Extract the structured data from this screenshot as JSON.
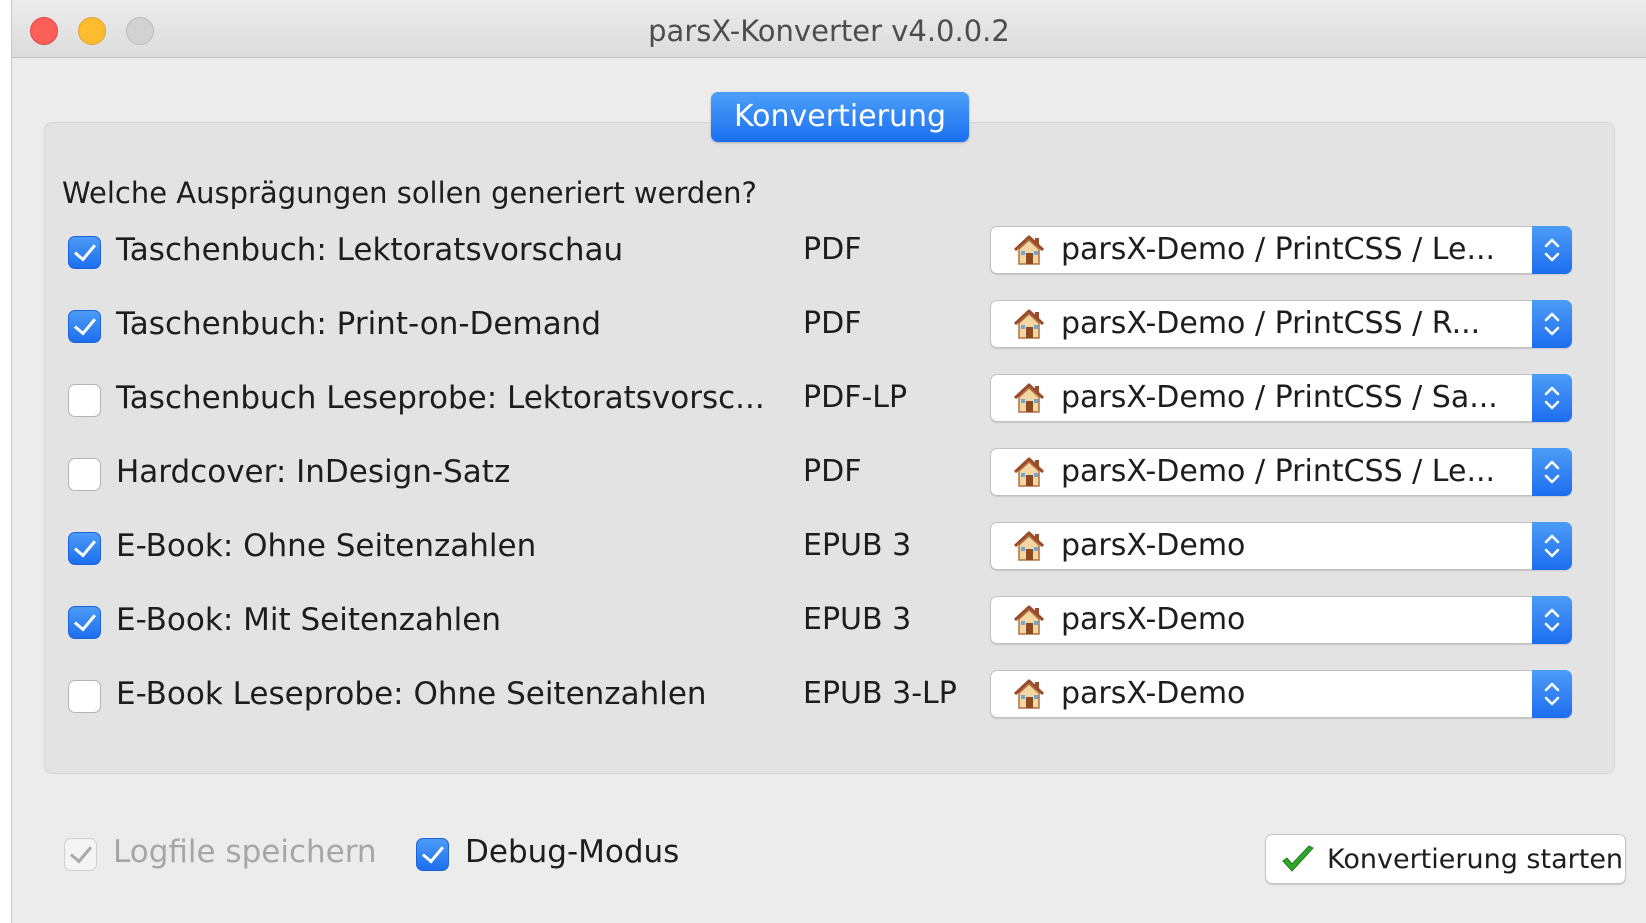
{
  "window": {
    "title": "parsX-Konverter v4.0.0.2"
  },
  "tab": {
    "label": "Konvertierung"
  },
  "question": "Welche Ausprägungen sollen generiert werden?",
  "rows": [
    {
      "checked": true,
      "label": "Taschenbuch: Lektoratsvorschau",
      "format": "PDF",
      "select": "parsX-Demo / PrintCSS / Le..."
    },
    {
      "checked": true,
      "label": "Taschenbuch: Print-on-Demand",
      "format": "PDF",
      "select": "parsX-Demo / PrintCSS / R..."
    },
    {
      "checked": false,
      "label": "Taschenbuch Leseprobe: Lektoratsvorsc...",
      "format": "PDF-LP",
      "select": "parsX-Demo / PrintCSS / Sa..."
    },
    {
      "checked": false,
      "label": "Hardcover: InDesign-Satz",
      "format": "PDF",
      "select": "parsX-Demo / PrintCSS / Le..."
    },
    {
      "checked": true,
      "label": "E-Book: Ohne Seitenzahlen",
      "format": "EPUB 3",
      "select": "parsX-Demo"
    },
    {
      "checked": true,
      "label": "E-Book: Mit Seitenzahlen",
      "format": "EPUB 3",
      "select": "parsX-Demo"
    },
    {
      "checked": false,
      "label": "E-Book Leseprobe: Ohne Seitenzahlen",
      "format": "EPUB 3-LP",
      "select": "parsX-Demo"
    }
  ],
  "select_icon": "house-icon",
  "footer": {
    "logfile_label": "Logfile speichern",
    "logfile_checked": true,
    "logfile_enabled": false,
    "debug_label": "Debug-Modus",
    "debug_checked": true,
    "start_label": "Konvertierung starten",
    "start_icon": "green-checkmark-icon"
  },
  "colors": {
    "accent": "#1d6ef0",
    "window_bg": "#ececec",
    "group_bg": "#e3e3e3",
    "check_green": "#2fa82a"
  }
}
